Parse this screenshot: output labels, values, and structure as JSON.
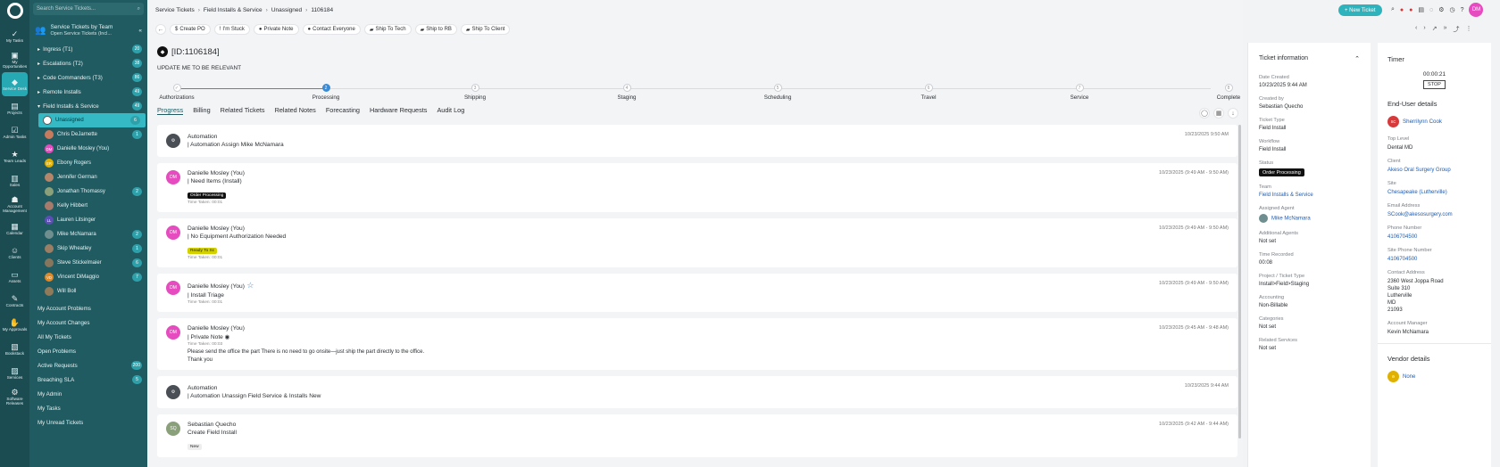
{
  "rail": [
    {
      "label": "My Tasks",
      "icon": "✓"
    },
    {
      "label": "My Opportunities",
      "icon": "▣"
    },
    {
      "label": "Service Desk",
      "icon": "◆",
      "active": true
    },
    {
      "label": "Projects",
      "icon": "▤"
    },
    {
      "label": "Admin Tasks",
      "icon": "☑"
    },
    {
      "label": "Team Leads",
      "icon": "★"
    },
    {
      "label": "Sales",
      "icon": "▥"
    },
    {
      "label": "Account Management",
      "icon": "☗"
    },
    {
      "label": "Calendar",
      "icon": "▦"
    },
    {
      "label": "Clients",
      "icon": "☺"
    },
    {
      "label": "Assets",
      "icon": "▭"
    },
    {
      "label": "Contracts",
      "icon": "✎"
    },
    {
      "label": "My Approvals",
      "icon": "✋"
    },
    {
      "label": "Bookstack",
      "icon": "▧"
    },
    {
      "label": "Services",
      "icon": "▨"
    },
    {
      "label": "Software Releases",
      "icon": "⚙"
    }
  ],
  "sidebar": {
    "search_placeholder": "Search Service Tickets...",
    "team_title": "Service Tickets by Team",
    "team_filter": "Open Service Tickets (Incl...",
    "groups": [
      {
        "label": "Ingress (T1)",
        "count": "20",
        "arrow": "▸"
      },
      {
        "label": "Escalations (T2)",
        "count": "38",
        "arrow": "▸"
      },
      {
        "label": "Code Commanders (T3)",
        "count": "86",
        "arrow": "▸"
      },
      {
        "label": "Remote Installs",
        "count": "49",
        "arrow": "▸"
      },
      {
        "label": "Field Installs & Service",
        "count": "49",
        "arrow": "▾"
      }
    ],
    "members": [
      {
        "name": "Unassigned",
        "count": "6",
        "initials": "",
        "color": "#fff",
        "active": true
      },
      {
        "name": "Chris DeJarnette",
        "count": "1",
        "initials": "",
        "color": "#c77b5e"
      },
      {
        "name": "Danielle Mosley (You)",
        "count": "",
        "initials": "DM",
        "color": "#e64bbf"
      },
      {
        "name": "Ebony Rogers",
        "count": "",
        "initials": "ER",
        "color": "#e0b100"
      },
      {
        "name": "Jennifer German",
        "count": "",
        "initials": "",
        "color": "#b6866a"
      },
      {
        "name": "Jonathan Thomassy",
        "count": "2",
        "initials": "",
        "color": "#8aa07a"
      },
      {
        "name": "Kelly Hibbert",
        "count": "",
        "initials": "",
        "color": "#a77b6c"
      },
      {
        "name": "Lauren Litsinger",
        "count": "",
        "initials": "LL",
        "color": "#5b4fb6"
      },
      {
        "name": "Mike McNamara",
        "count": "2",
        "initials": "",
        "color": "#6f8e8f"
      },
      {
        "name": "Skip Wheatley",
        "count": "1",
        "initials": "",
        "color": "#9b7e63"
      },
      {
        "name": "Steve Stickelmaier",
        "count": "6",
        "initials": "",
        "color": "#86765e"
      },
      {
        "name": "Vincent DiMaggio",
        "count": "7",
        "initials": "VD",
        "color": "#e08a27"
      },
      {
        "name": "Will Boll",
        "count": "",
        "initials": "",
        "color": "#8f7a5a"
      }
    ],
    "links": [
      {
        "label": "My Account Problems",
        "count": ""
      },
      {
        "label": "My Account Changes",
        "count": ""
      },
      {
        "label": "All My Tickets",
        "count": ""
      },
      {
        "label": "Open Problems",
        "count": ""
      },
      {
        "label": "Active Requests",
        "count": "200"
      },
      {
        "label": "Breaching SLA",
        "count": "5"
      },
      {
        "label": "My Admin",
        "count": ""
      },
      {
        "label": "My Tasks",
        "count": ""
      },
      {
        "label": "My Unread Tickets",
        "count": ""
      }
    ]
  },
  "breadcrumb": [
    "Service Tickets",
    "Field Installs & Service",
    "Unassigned",
    "1106184"
  ],
  "new_ticket": "+ New Ticket",
  "user_initials": "DM",
  "actions": [
    {
      "label": "Create PO",
      "icon": "$"
    },
    {
      "label": "I'm Stuck",
      "icon": "!"
    },
    {
      "label": "Private Note",
      "icon": "●"
    },
    {
      "label": "Contact Everyone",
      "icon": "●"
    },
    {
      "label": "Ship To Tech",
      "icon": "▰"
    },
    {
      "label": "Ship to RB",
      "icon": "▰"
    },
    {
      "label": "Ship To Client",
      "icon": "▰"
    }
  ],
  "ticket": {
    "id": "[ID:1106184]",
    "subject": "UPDATE ME TO BE RELEVANT"
  },
  "stages": [
    {
      "label": "Authorizations",
      "num": "✓",
      "current": false
    },
    {
      "label": "Processing",
      "num": "2",
      "current": true
    },
    {
      "label": "Shipping",
      "num": "3",
      "current": false
    },
    {
      "label": "Staging",
      "num": "4",
      "current": false
    },
    {
      "label": "Scheduling",
      "num": "5",
      "current": false
    },
    {
      "label": "Travel",
      "num": "6",
      "current": false
    },
    {
      "label": "Service",
      "num": "7",
      "current": false
    },
    {
      "label": "Complete",
      "num": "8",
      "current": false
    }
  ],
  "tabs": [
    {
      "label": "Progress",
      "active": true
    },
    {
      "label": "Billing"
    },
    {
      "label": "Related Tickets"
    },
    {
      "label": "Related Notes"
    },
    {
      "label": "Forecasting"
    },
    {
      "label": "Hardware Requests"
    },
    {
      "label": "Audit Log"
    }
  ],
  "feed": [
    {
      "who": "Automation",
      "avatar": "⚙",
      "avatar_color": "#4a4f55",
      "line": "| Automation Assign Mike McNamara",
      "tag": "",
      "tag_color": "",
      "time_taken": "",
      "note": [],
      "time": "10/23/2025 9:50 AM"
    },
    {
      "who": "Danielle Mosley (You)",
      "avatar": "DM",
      "avatar_color": "#e64bbf",
      "line": "| Need Items (Install)",
      "tag": "Order Processing",
      "tag_color": "#111",
      "time_taken": "Time Taken: 00:01",
      "note": [],
      "time": "10/23/2025 (9:49 AM - 9:50 AM)"
    },
    {
      "who": "Danielle Mosley (You)",
      "avatar": "DM",
      "avatar_color": "#e64bbf",
      "line": "| No Equipment Authorization Needed",
      "tag": "Ready To Sc",
      "tag_color": "#d4d100",
      "time_taken": "Time Taken: 00:01",
      "note": [],
      "time": "10/23/2025 (9:49 AM - 9:50 AM)"
    },
    {
      "who": "Danielle Mosley (You)",
      "avatar": "DM",
      "avatar_color": "#e64bbf",
      "line": "| Install Triage",
      "tag": "",
      "tag_color": "",
      "time_taken": "Time Taken: 00:01",
      "note": [],
      "time": "10/23/2025 (9:49 AM - 9:50 AM)",
      "star": true
    },
    {
      "who": "Danielle Mosley (You)",
      "avatar": "DM",
      "avatar_color": "#e64bbf",
      "line": "| Private Note",
      "tag": "",
      "tag_color": "",
      "time_taken": "Time Taken: 00:03",
      "note": [
        "Please send the office the part There is no need to go onsite—just ship the part directly to the office.",
        "Thank you"
      ],
      "time": "10/23/2025 (9:45 AM - 9:48 AM)",
      "eye": true
    },
    {
      "who": "Automation",
      "avatar": "⚙",
      "avatar_color": "#4a4f55",
      "line": "| Automation Unassign Field Service & Installs New",
      "tag": "",
      "tag_color": "",
      "time_taken": "",
      "note": [],
      "time": "10/23/2025 9:44 AM"
    },
    {
      "who": "Sebastian Quecho",
      "avatar": "SQ",
      "avatar_color": "#8aa07a",
      "line": "Create Field Install",
      "tag": "New",
      "tag_color": "#eee",
      "time_taken": "",
      "note": [],
      "time": "10/23/2025 (9:42 AM - 9:44 AM)"
    }
  ],
  "ticket_info": {
    "title": "Ticket information",
    "fields": [
      {
        "label": "Date Created",
        "value": "10/23/2025 9:44 AM"
      },
      {
        "label": "Created by",
        "value": "Sebastian Quecho"
      },
      {
        "label": "Ticket Type",
        "value": "Field Install"
      },
      {
        "label": "Workflow",
        "value": "Field Install"
      },
      {
        "label": "Status",
        "value": "Order Processing",
        "pill": true
      },
      {
        "label": "Team",
        "value": "Field Installs & Service",
        "link": true
      },
      {
        "label": "Assigned Agent",
        "value": "Mike McNamara",
        "link": true,
        "avatar": true
      },
      {
        "label": "Additional Agents",
        "value": "Not set"
      },
      {
        "label": "Time Recorded",
        "value": "00:08"
      },
      {
        "label": "Project / Ticket Type",
        "value": "Install>Field>Staging"
      },
      {
        "label": "Accounting",
        "value": "Non-Billable"
      },
      {
        "label": "Categories",
        "value": "Not set"
      },
      {
        "label": "Related Services",
        "value": "Not set"
      }
    ]
  },
  "timer": {
    "title": "Timer",
    "value": "00:00:21",
    "stop": "STOP"
  },
  "end_user": {
    "title": "End-User details",
    "name": "Sherrilynn Cook",
    "initials": "SC",
    "fields": [
      {
        "label": "Top Level",
        "value": "Dental MD"
      },
      {
        "label": "Client",
        "value": "Akeso Oral Surgery Group",
        "link": true
      },
      {
        "label": "Site",
        "value": "Chesapeake (Lutherville)",
        "link": true
      },
      {
        "label": "Email Address",
        "value": "SCook@akesosurgery.com",
        "link": true
      },
      {
        "label": "Phone Number",
        "value": "4106704500",
        "link": true
      },
      {
        "label": "Site Phone Number",
        "value": "4106704500",
        "link": true
      },
      {
        "label": "Contact Address",
        "value": "2360 West Joppa Road\nSuite 310\nLutherville\nMD\n21093"
      },
      {
        "label": "Account Manager",
        "value": "Kevin McNamara"
      }
    ]
  },
  "vendor": {
    "title": "Vendor details",
    "value": "None"
  }
}
